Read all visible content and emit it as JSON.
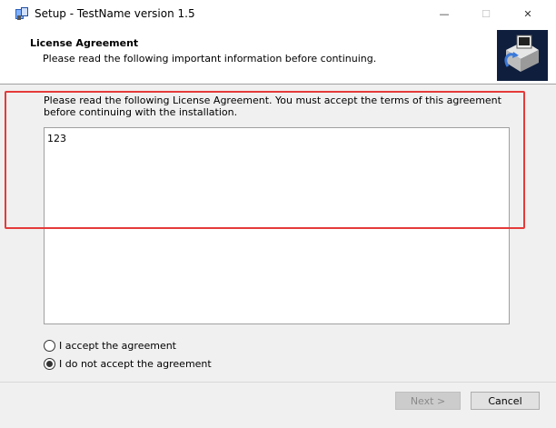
{
  "window": {
    "title": "Setup - TestName version 1.5",
    "controls": {
      "minimize": "—",
      "maximize": "☐",
      "close": "✕"
    }
  },
  "header": {
    "title": "License Agreement",
    "subtitle": "Please read the following important information before continuing."
  },
  "content": {
    "intro": "Please read the following License Agreement. You must accept the terms of this agreement before continuing with the installation.",
    "license_text": "123"
  },
  "options": [
    {
      "label": "I accept the agreement",
      "checked": false
    },
    {
      "label": "I do not accept the agreement",
      "checked": true
    }
  ],
  "buttons": {
    "next": "Next >",
    "cancel": "Cancel"
  },
  "colors": {
    "highlight": "#e53a3a",
    "window_bg": "#f0f0f0"
  }
}
